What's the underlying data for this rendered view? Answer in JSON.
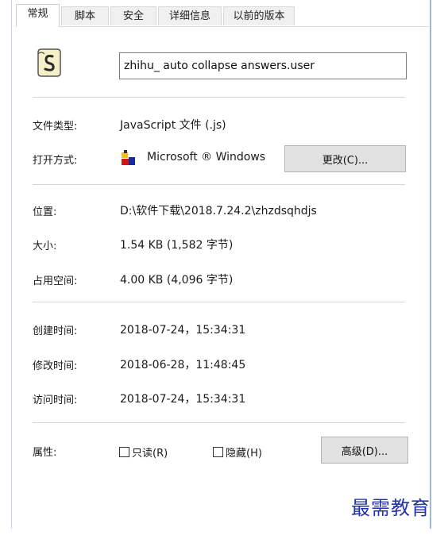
{
  "tabs": [
    {
      "label": "常规",
      "active": true
    },
    {
      "label": "脚本"
    },
    {
      "label": "安全"
    },
    {
      "label": "详细信息"
    },
    {
      "label": "以前的版本"
    }
  ],
  "file": {
    "icon": "script-file-icon",
    "name": "zhihu_ auto collapse answers.user"
  },
  "type_section": {
    "file_type_label": "文件类型:",
    "file_type_value": "JavaScript 文件 (.js)",
    "open_with_label": "打开方式:",
    "open_with_value": "Microsoft ® Windows",
    "open_with_icon": "windows-script-host-icon",
    "change_button": "更改(C)..."
  },
  "location_section": {
    "location_label": "位置:",
    "location_value": "D:\\软件下载\\2018.7.24.2\\zhzdsqhdjs",
    "size_label": "大小:",
    "size_value": "1.54 KB (1,582 字节)",
    "disk_size_label": "占用空间:",
    "disk_size_value": "4.00 KB (4,096 字节)"
  },
  "time_section": {
    "created_label": "创建时间:",
    "created_value": "2018-07-24，15:34:31",
    "modified_label": "修改时间:",
    "modified_value": "2018-06-28，11:48:45",
    "accessed_label": "访问时间:",
    "accessed_value": "2018-07-24，15:34:31"
  },
  "attributes": {
    "label": "属性:",
    "readonly": {
      "label": "只读(R)",
      "checked": false
    },
    "hidden": {
      "label": "隐藏(H)",
      "checked": false
    },
    "advanced_button": "高级(D)..."
  },
  "watermark": "最需教育"
}
